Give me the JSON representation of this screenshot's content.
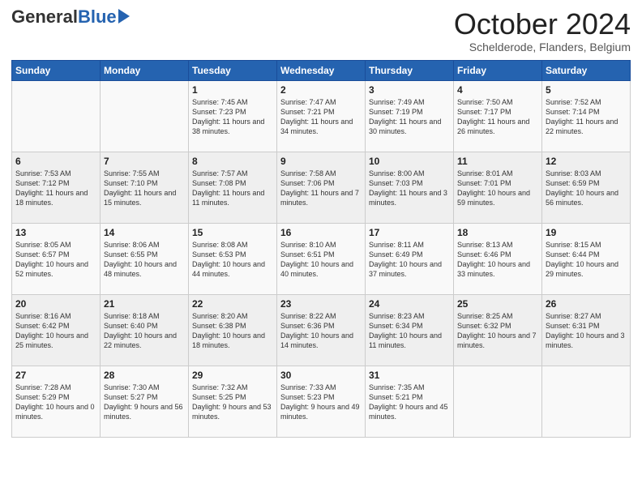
{
  "header": {
    "logo_general": "General",
    "logo_blue": "Blue",
    "month_title": "October 2024",
    "location": "Schelderode, Flanders, Belgium"
  },
  "days_of_week": [
    "Sunday",
    "Monday",
    "Tuesday",
    "Wednesday",
    "Thursday",
    "Friday",
    "Saturday"
  ],
  "weeks": [
    [
      {
        "day": "",
        "sunrise": "",
        "sunset": "",
        "daylight": ""
      },
      {
        "day": "",
        "sunrise": "",
        "sunset": "",
        "daylight": ""
      },
      {
        "day": "1",
        "sunrise": "Sunrise: 7:45 AM",
        "sunset": "Sunset: 7:23 PM",
        "daylight": "Daylight: 11 hours and 38 minutes."
      },
      {
        "day": "2",
        "sunrise": "Sunrise: 7:47 AM",
        "sunset": "Sunset: 7:21 PM",
        "daylight": "Daylight: 11 hours and 34 minutes."
      },
      {
        "day": "3",
        "sunrise": "Sunrise: 7:49 AM",
        "sunset": "Sunset: 7:19 PM",
        "daylight": "Daylight: 11 hours and 30 minutes."
      },
      {
        "day": "4",
        "sunrise": "Sunrise: 7:50 AM",
        "sunset": "Sunset: 7:17 PM",
        "daylight": "Daylight: 11 hours and 26 minutes."
      },
      {
        "day": "5",
        "sunrise": "Sunrise: 7:52 AM",
        "sunset": "Sunset: 7:14 PM",
        "daylight": "Daylight: 11 hours and 22 minutes."
      }
    ],
    [
      {
        "day": "6",
        "sunrise": "Sunrise: 7:53 AM",
        "sunset": "Sunset: 7:12 PM",
        "daylight": "Daylight: 11 hours and 18 minutes."
      },
      {
        "day": "7",
        "sunrise": "Sunrise: 7:55 AM",
        "sunset": "Sunset: 7:10 PM",
        "daylight": "Daylight: 11 hours and 15 minutes."
      },
      {
        "day": "8",
        "sunrise": "Sunrise: 7:57 AM",
        "sunset": "Sunset: 7:08 PM",
        "daylight": "Daylight: 11 hours and 11 minutes."
      },
      {
        "day": "9",
        "sunrise": "Sunrise: 7:58 AM",
        "sunset": "Sunset: 7:06 PM",
        "daylight": "Daylight: 11 hours and 7 minutes."
      },
      {
        "day": "10",
        "sunrise": "Sunrise: 8:00 AM",
        "sunset": "Sunset: 7:03 PM",
        "daylight": "Daylight: 11 hours and 3 minutes."
      },
      {
        "day": "11",
        "sunrise": "Sunrise: 8:01 AM",
        "sunset": "Sunset: 7:01 PM",
        "daylight": "Daylight: 10 hours and 59 minutes."
      },
      {
        "day": "12",
        "sunrise": "Sunrise: 8:03 AM",
        "sunset": "Sunset: 6:59 PM",
        "daylight": "Daylight: 10 hours and 56 minutes."
      }
    ],
    [
      {
        "day": "13",
        "sunrise": "Sunrise: 8:05 AM",
        "sunset": "Sunset: 6:57 PM",
        "daylight": "Daylight: 10 hours and 52 minutes."
      },
      {
        "day": "14",
        "sunrise": "Sunrise: 8:06 AM",
        "sunset": "Sunset: 6:55 PM",
        "daylight": "Daylight: 10 hours and 48 minutes."
      },
      {
        "day": "15",
        "sunrise": "Sunrise: 8:08 AM",
        "sunset": "Sunset: 6:53 PM",
        "daylight": "Daylight: 10 hours and 44 minutes."
      },
      {
        "day": "16",
        "sunrise": "Sunrise: 8:10 AM",
        "sunset": "Sunset: 6:51 PM",
        "daylight": "Daylight: 10 hours and 40 minutes."
      },
      {
        "day": "17",
        "sunrise": "Sunrise: 8:11 AM",
        "sunset": "Sunset: 6:49 PM",
        "daylight": "Daylight: 10 hours and 37 minutes."
      },
      {
        "day": "18",
        "sunrise": "Sunrise: 8:13 AM",
        "sunset": "Sunset: 6:46 PM",
        "daylight": "Daylight: 10 hours and 33 minutes."
      },
      {
        "day": "19",
        "sunrise": "Sunrise: 8:15 AM",
        "sunset": "Sunset: 6:44 PM",
        "daylight": "Daylight: 10 hours and 29 minutes."
      }
    ],
    [
      {
        "day": "20",
        "sunrise": "Sunrise: 8:16 AM",
        "sunset": "Sunset: 6:42 PM",
        "daylight": "Daylight: 10 hours and 25 minutes."
      },
      {
        "day": "21",
        "sunrise": "Sunrise: 8:18 AM",
        "sunset": "Sunset: 6:40 PM",
        "daylight": "Daylight: 10 hours and 22 minutes."
      },
      {
        "day": "22",
        "sunrise": "Sunrise: 8:20 AM",
        "sunset": "Sunset: 6:38 PM",
        "daylight": "Daylight: 10 hours and 18 minutes."
      },
      {
        "day": "23",
        "sunrise": "Sunrise: 8:22 AM",
        "sunset": "Sunset: 6:36 PM",
        "daylight": "Daylight: 10 hours and 14 minutes."
      },
      {
        "day": "24",
        "sunrise": "Sunrise: 8:23 AM",
        "sunset": "Sunset: 6:34 PM",
        "daylight": "Daylight: 10 hours and 11 minutes."
      },
      {
        "day": "25",
        "sunrise": "Sunrise: 8:25 AM",
        "sunset": "Sunset: 6:32 PM",
        "daylight": "Daylight: 10 hours and 7 minutes."
      },
      {
        "day": "26",
        "sunrise": "Sunrise: 8:27 AM",
        "sunset": "Sunset: 6:31 PM",
        "daylight": "Daylight: 10 hours and 3 minutes."
      }
    ],
    [
      {
        "day": "27",
        "sunrise": "Sunrise: 7:28 AM",
        "sunset": "Sunset: 5:29 PM",
        "daylight": "Daylight: 10 hours and 0 minutes."
      },
      {
        "day": "28",
        "sunrise": "Sunrise: 7:30 AM",
        "sunset": "Sunset: 5:27 PM",
        "daylight": "Daylight: 9 hours and 56 minutes."
      },
      {
        "day": "29",
        "sunrise": "Sunrise: 7:32 AM",
        "sunset": "Sunset: 5:25 PM",
        "daylight": "Daylight: 9 hours and 53 minutes."
      },
      {
        "day": "30",
        "sunrise": "Sunrise: 7:33 AM",
        "sunset": "Sunset: 5:23 PM",
        "daylight": "Daylight: 9 hours and 49 minutes."
      },
      {
        "day": "31",
        "sunrise": "Sunrise: 7:35 AM",
        "sunset": "Sunset: 5:21 PM",
        "daylight": "Daylight: 9 hours and 45 minutes."
      },
      {
        "day": "",
        "sunrise": "",
        "sunset": "",
        "daylight": ""
      },
      {
        "day": "",
        "sunrise": "",
        "sunset": "",
        "daylight": ""
      }
    ]
  ]
}
